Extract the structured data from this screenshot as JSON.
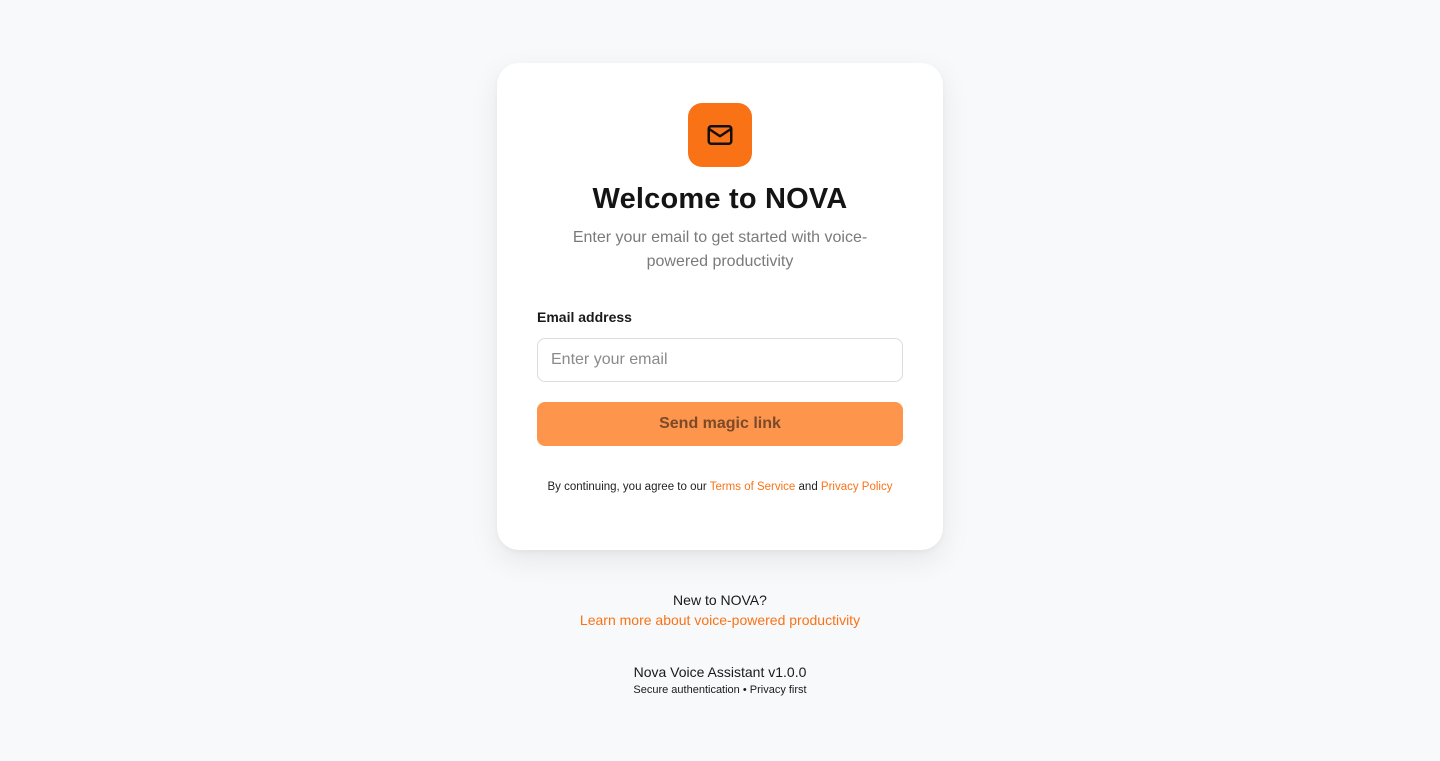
{
  "card": {
    "icon": "mail-icon",
    "title": "Welcome to NOVA",
    "subtitle": "Enter your email to get started with voice-powered productivity",
    "email_label": "Email address",
    "email_placeholder": "Enter your email",
    "email_value": "",
    "submit_label": "Send magic link",
    "legal": {
      "prefix": "By continuing, you agree to our ",
      "terms_link": "Terms of Service",
      "and": " and ",
      "privacy_link": "Privacy Policy"
    }
  },
  "below_card": {
    "question": "New to NOVA?",
    "learn_link": "Learn more about voice-powered productivity"
  },
  "footer": {
    "version": "Nova Voice Assistant v1.0.0",
    "tagline": "Secure authentication • Privacy first"
  },
  "colors": {
    "accent": "#f97316",
    "button": "#fd964c",
    "background": "#f8f9fb"
  }
}
